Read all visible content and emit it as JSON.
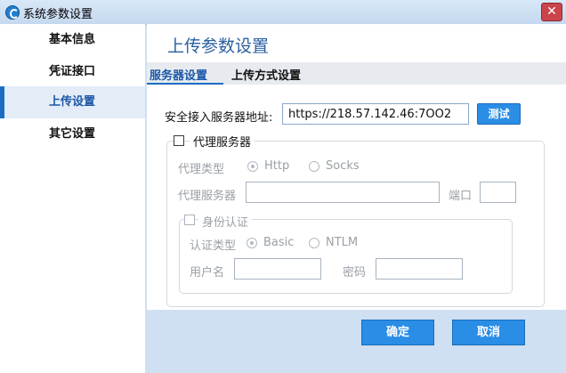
{
  "window": {
    "title": "系统参数设置",
    "close_glyph": "✕"
  },
  "sidebar": {
    "items": [
      {
        "label": "基本信息",
        "active": false
      },
      {
        "label": "凭证接口",
        "active": false
      },
      {
        "label": "上传设置",
        "active": true
      },
      {
        "label": "其它设置",
        "active": false
      }
    ]
  },
  "main": {
    "page_title": "上传参数设置",
    "tabs": [
      {
        "label": "服务器设置",
        "active": true
      },
      {
        "label": "上传方式设置",
        "active": false
      }
    ]
  },
  "server": {
    "address_label": "安全接入服务器地址:",
    "address_value": "https://218.57.142.46:7OO2",
    "test_button": "测试"
  },
  "proxy": {
    "checkbox_label": "代理服务器",
    "checked": false,
    "type_label": "代理类型",
    "type_options": [
      "Http",
      "Socks"
    ],
    "type_selected": "Http",
    "server_label": "代理服务器",
    "server_value": "",
    "port_label": "端口",
    "port_value": "",
    "auth": {
      "checkbox_label": "身份认证",
      "checked": false,
      "type_label": "认证类型",
      "type_options": [
        "Basic",
        "NTLM"
      ],
      "type_selected": "Basic",
      "username_label": "用户名",
      "username_value": "",
      "password_label": "密码",
      "password_value": ""
    }
  },
  "buttons": {
    "ok": "确定",
    "cancel": "取消"
  },
  "colors": {
    "accent": "#2a8de6",
    "active_nav_bar": "#1d6cc4",
    "title_text": "#2a5fa0",
    "window_bg": "#cfe0f3"
  }
}
